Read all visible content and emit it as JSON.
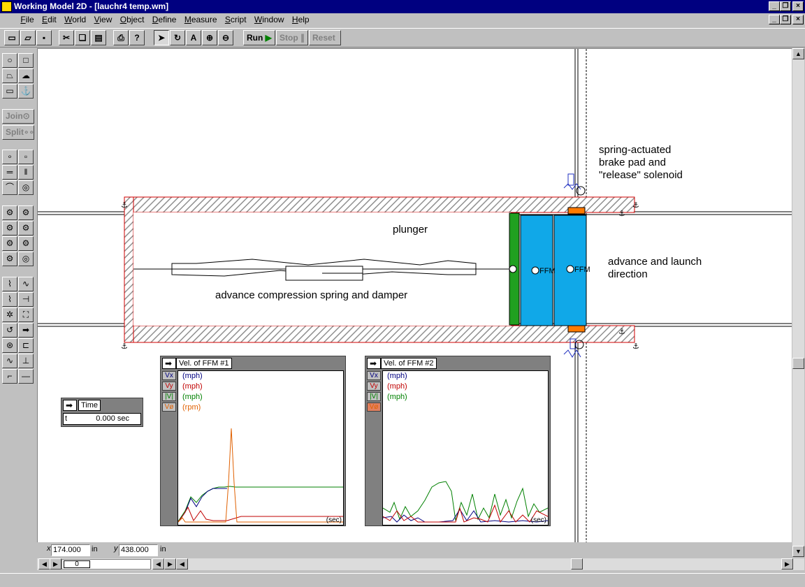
{
  "window": {
    "title": "Working Model 2D - [lauchr4 temp.wm]"
  },
  "menu": [
    "File",
    "Edit",
    "World",
    "View",
    "Object",
    "Define",
    "Measure",
    "Script",
    "Window",
    "Help"
  ],
  "toolbar": {
    "run": "Run",
    "stop": "Stop",
    "reset": "Reset"
  },
  "palette": {
    "join": "Join",
    "split": "Split"
  },
  "annotations": {
    "plunger": "plunger",
    "spring_damper": "advance compression spring and damper",
    "brake_line1": "spring-actuated",
    "brake_line2": "brake pad and",
    "brake_line3": "\"release\" solenoid",
    "advance_line1": "advance and launch",
    "advance_line2": "direction",
    "ffm": "FFM"
  },
  "time_meter": {
    "title": "Time",
    "label": "t",
    "value": "0.000 sec"
  },
  "meter1": {
    "title": "Vel. of FFM #1",
    "legend": [
      {
        "key": "Vx",
        "unit": "(mph)",
        "color": "#000080"
      },
      {
        "key": "Vy",
        "unit": "(mph)",
        "color": "#c00000"
      },
      {
        "key": "|V|",
        "unit": "(mph)",
        "color": "#008000"
      },
      {
        "key": "Vø",
        "unit": "(rpm)",
        "color": "#e06000"
      }
    ],
    "axis_unit": "(sec)"
  },
  "meter2": {
    "title": "Vel. of FFM #2",
    "legend": [
      {
        "key": "Vx",
        "unit": "(mph)",
        "color": "#000080"
      },
      {
        "key": "Vy",
        "unit": "(mph)",
        "color": "#c00000"
      },
      {
        "key": "|V|",
        "unit": "(mph)",
        "color": "#008000"
      },
      {
        "key": "Vø",
        "unit": "",
        "color": "#e06000"
      }
    ],
    "axis_unit": "(sec)"
  },
  "coords": {
    "x_label": "x",
    "x_value": "174.000",
    "x_unit": "in",
    "y_label": "y",
    "y_value": "438.000",
    "y_unit": "in"
  },
  "frame": {
    "value": "0"
  }
}
